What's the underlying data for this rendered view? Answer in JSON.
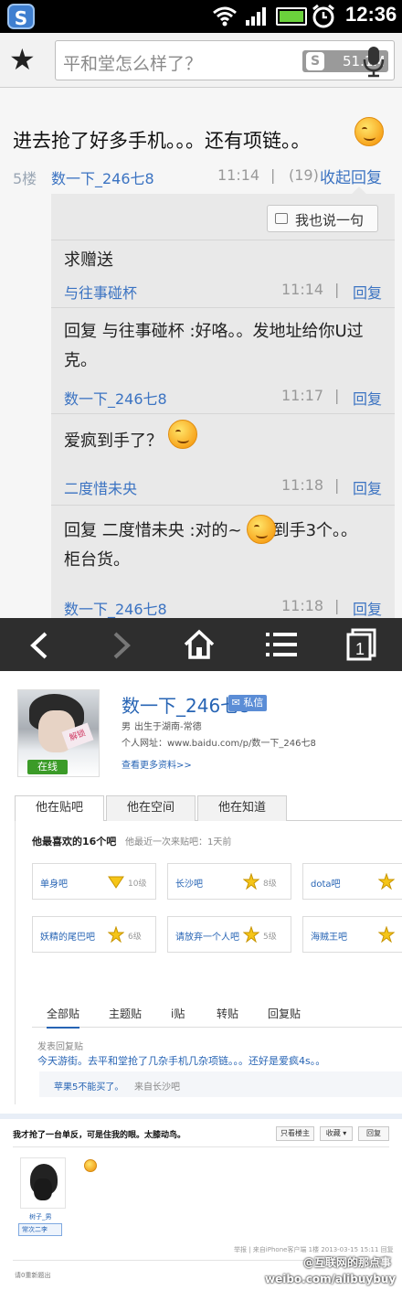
{
  "status_bar": {
    "time": "12:36"
  },
  "url_bar": {
    "search_text": "平和堂怎么样了？",
    "badge_text": "51.1M"
  },
  "post": {
    "content": "进去抢了好多手机。。。还有项链。。",
    "floor": "5楼",
    "author": "数一下_246七8",
    "time": "11:14",
    "separator": "|",
    "reply_count": "(19)",
    "collapse_label": "收起回复",
    "say_button": "我也说一句",
    "replies": [
      {
        "text": "求赠送",
        "user": "与往事碰杯",
        "time": "11:14",
        "sep": "|",
        "reply_label": "回复"
      },
      {
        "text": "回复 与往事碰杯 :好咯。。发地址给你U过克。",
        "user": "数一下_246七8",
        "time": "11:17",
        "sep": "|",
        "reply_label": "回复"
      },
      {
        "text": "爱疯到手了？",
        "user": "二度惜未央",
        "time": "11:18",
        "sep": "|",
        "reply_label": "回复"
      },
      {
        "text_a": "回复 二度惜未央 :对的~",
        "text_b": "到手3个。。",
        "text_c": "柜台货。",
        "user": "数一下_246七8",
        "time": "11:18",
        "sep": "|",
        "reply_label": "回复"
      }
    ]
  },
  "profile": {
    "avatar_tag": "解锁",
    "online_label": "在线",
    "name": "数一下_246七8",
    "message_button": "✉ 私信",
    "gender": "男",
    "born": "出生于湖南-常德",
    "website": "个人网址：www.baidu.com/p/数一下_246七8",
    "more_link": "查看更多资料>>",
    "tabs": [
      "他在贴吧",
      "他在空间",
      "他在知道"
    ],
    "fav_title": "他最喜欢的16个吧",
    "fav_subtitle": "他最近一次来贴吧：1天前",
    "favorites": [
      {
        "name": "单身吧",
        "level": "10级"
      },
      {
        "name": "长沙吧",
        "level": "8级"
      },
      {
        "name": "dota吧",
        "level": ""
      },
      {
        "name": "妖精的尾巴吧",
        "level": "6级"
      },
      {
        "name": "请放弃一个人吧",
        "level": "5级"
      },
      {
        "name": "海贼王吧",
        "level": ""
      }
    ],
    "list_tabs": [
      "全部贴",
      "主题贴",
      "i贴",
      "转贴",
      "回复贴"
    ],
    "reply_header": "发表回复贴",
    "reply_body": "今天游街。去平和堂抢了几杂手机几杂项链。。。还好是爱疯4s。。",
    "quote_title": "苹果5不能买了。",
    "quote_from": "来自长沙吧"
  },
  "webpost": {
    "title": "我才抢了一台单反，可是住我的眼。太膝动鸟。",
    "buttons": [
      "只看楼主",
      "收藏 ▾",
      "回复"
    ],
    "username": "树子_男",
    "level_label": "常次二李",
    "footer": "举报 | 来自iPhone客户端 1楼 2013-03-15 15:11 回复",
    "bottom_text": "请0重新题出",
    "watermark_1": "@互联网的那点事",
    "watermark_2": "weibo.com/alibuybuy"
  },
  "colors": {
    "link_blue": "#3b73c2",
    "nav_bg": "#2e2e2e",
    "status_bg": "#000000"
  }
}
